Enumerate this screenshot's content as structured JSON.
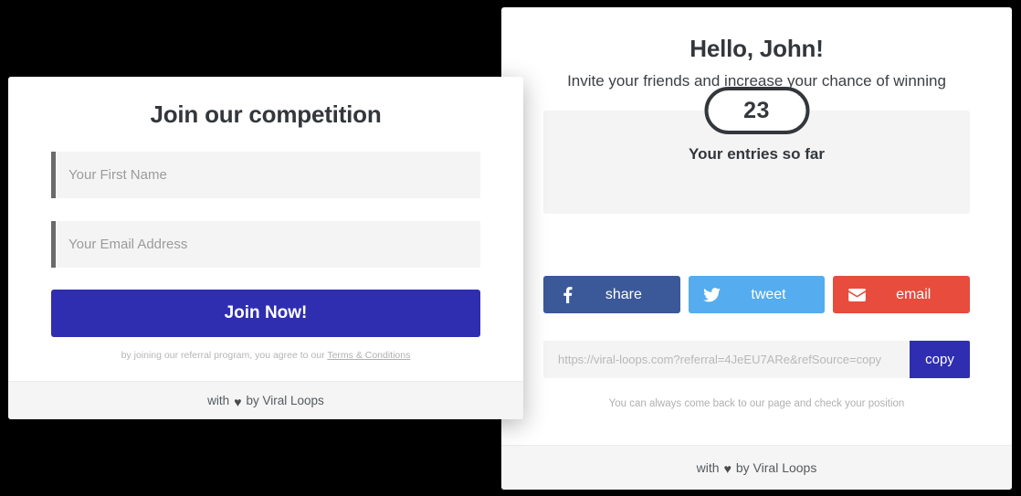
{
  "colors": {
    "primary": "#2f2eb0",
    "facebook": "#3b5998",
    "twitter": "#55acee",
    "email": "#e74c3c",
    "panel_grey": "#f4f4f4",
    "footer_grey": "#f5f5f5",
    "text_dark": "#33373b"
  },
  "signup_card": {
    "title": "Join our competition",
    "fields": [
      {
        "name": "first-name",
        "value": "",
        "placeholder": "Your First Name"
      },
      {
        "name": "email",
        "value": "",
        "placeholder": "Your Email Address"
      }
    ],
    "submit_label": "Join Now!",
    "terms_text": "by joining our referral program, you agree to our ",
    "terms_link_label": "Terms & Conditions",
    "footer": {
      "prefix": "with",
      "heart": "♥",
      "suffix": "by Viral Loops"
    }
  },
  "dashboard_card": {
    "title": "Hello, John!",
    "subtitle": "Invite your friends and increase your chance of winning",
    "entries": {
      "label": "Your entries so far",
      "count": "23"
    },
    "share_buttons": [
      {
        "name": "facebook",
        "icon": "facebook-icon",
        "label": "share"
      },
      {
        "name": "twitter",
        "icon": "twitter-icon",
        "label": "tweet"
      },
      {
        "name": "email",
        "icon": "envelope-icon",
        "label": "email"
      }
    ],
    "referral": {
      "url": "https://viral-loops.com?referral=4JeEU7ARe&refSource=copy",
      "copy_label": "copy"
    },
    "note": "You can always come back to our page and check your position",
    "footer": {
      "prefix": "with",
      "heart": "♥",
      "suffix": "by Viral Loops"
    }
  }
}
